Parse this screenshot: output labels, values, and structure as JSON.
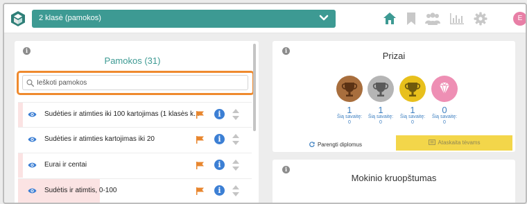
{
  "header": {
    "class_select": "2 klasė (pamokos)",
    "user_initial": "E",
    "nav_icons": [
      "home-icon",
      "bookmark-icon",
      "users-icon",
      "chart-icon",
      "gear-icon"
    ],
    "accent_color": "#3d9a93",
    "active_nav_color": "#3d9a93",
    "inactive_nav_color": "#c8c8c8"
  },
  "lessons": {
    "title": "Pamokos (31)",
    "search_placeholder": "Ieškoti pamokos",
    "highlight_color": "#ef8a2e",
    "items": [
      {
        "name": "Sudėties ir atimties iki 100 kartojimas (1 klasės k...",
        "progress": 0.02
      },
      {
        "name": "Sudėties ir atimties kartojimas iki 20",
        "progress": 0.0
      },
      {
        "name": "Eurai ir centai",
        "progress": 0.02
      },
      {
        "name": "Sudėtis ir atimtis, 0-100",
        "progress": 0.35
      }
    ]
  },
  "prizes": {
    "title": "Prizai",
    "items": [
      {
        "type": "bronze",
        "count": "1",
        "week_label": "Šią savaitę:",
        "week_count": "0",
        "color": "#a86e3d"
      },
      {
        "type": "silver",
        "count": "1",
        "week_label": "Šią savaitę:",
        "week_count": "0",
        "color": "#b5b5b5"
      },
      {
        "type": "gold",
        "count": "1",
        "week_label": "Šią savaitę:",
        "week_count": "0",
        "color": "#e8c01c"
      },
      {
        "type": "diamond",
        "count": "0",
        "week_label": "Šią savaitę:",
        "week_count": "0",
        "color": "#ee8fb4"
      }
    ],
    "diplomas_button": "Parengti diplomus",
    "parents_button": "Ataskaita tėvams"
  },
  "diligence": {
    "title": "Mokinio kruopštumas"
  }
}
